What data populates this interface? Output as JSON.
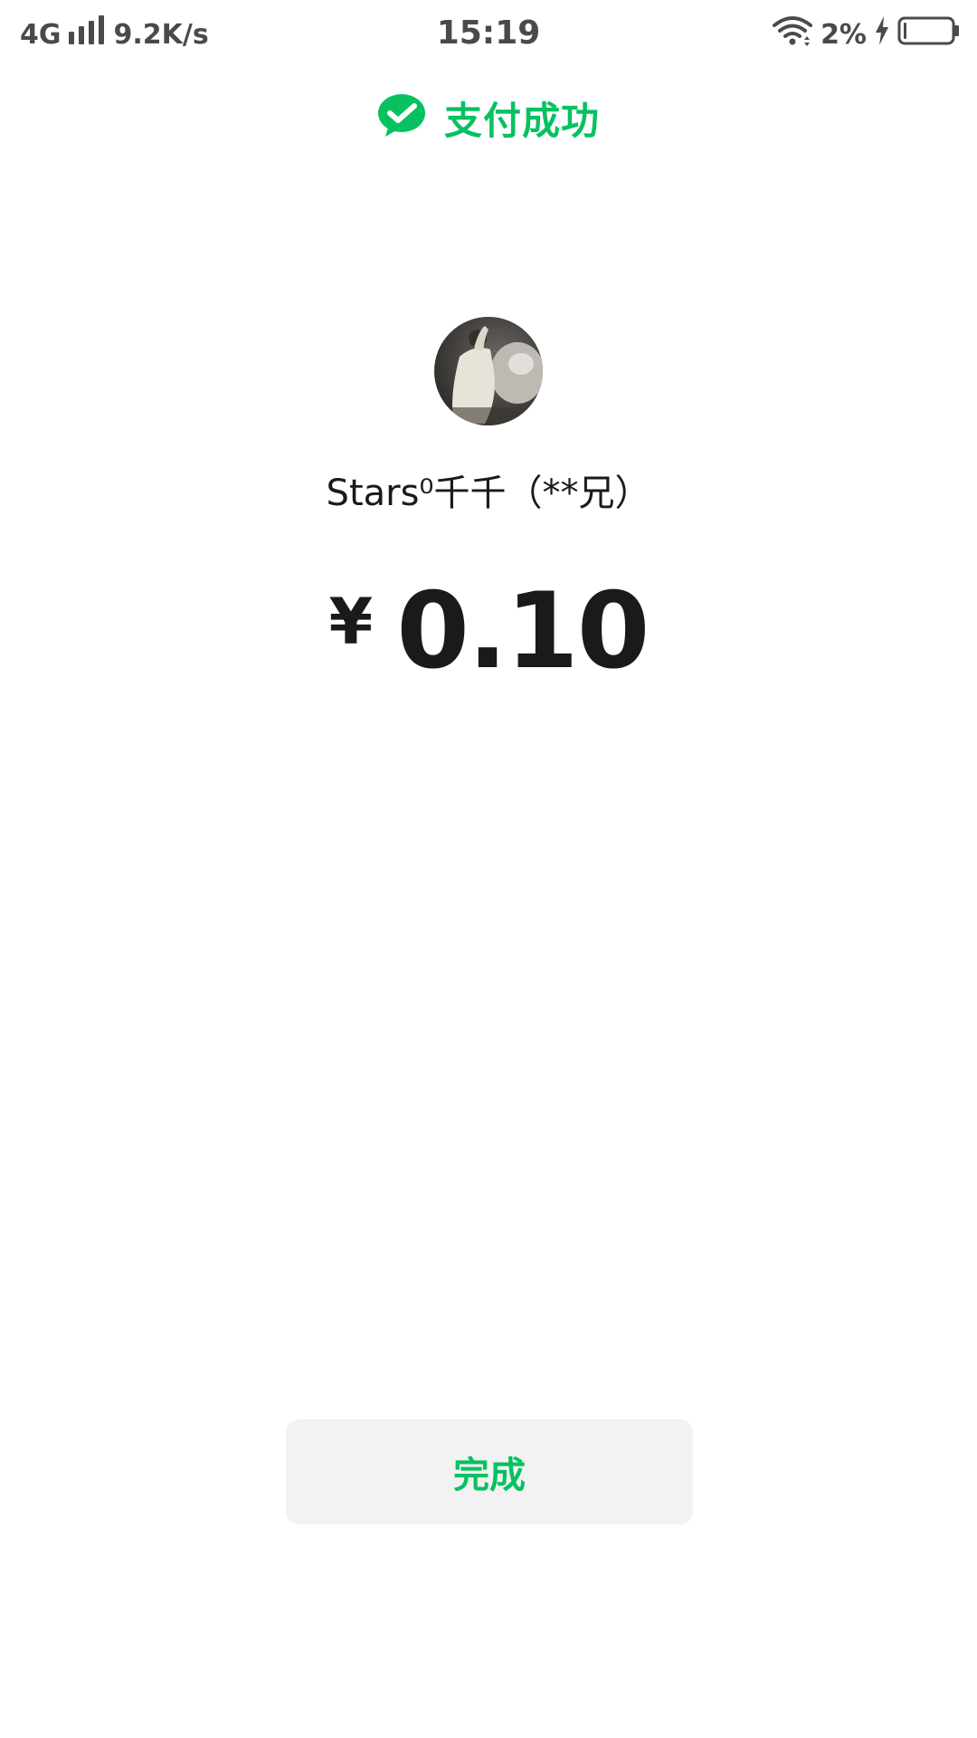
{
  "status_bar": {
    "network": "4G",
    "speed": "9.2K/s",
    "time": "15:19",
    "battery": "2%"
  },
  "header": {
    "title": "支付成功",
    "icon": "wechat-pay-check-icon"
  },
  "payee": {
    "name": "Stars⁰千千（**兄）"
  },
  "payment": {
    "currency": "¥",
    "amount": "0.10"
  },
  "actions": {
    "done_label": "完成"
  },
  "colors": {
    "brand_green": "#07c160",
    "button_bg": "#f2f2f2",
    "text_dark": "#1a1a1a",
    "status_text": "#4a4a4a"
  }
}
